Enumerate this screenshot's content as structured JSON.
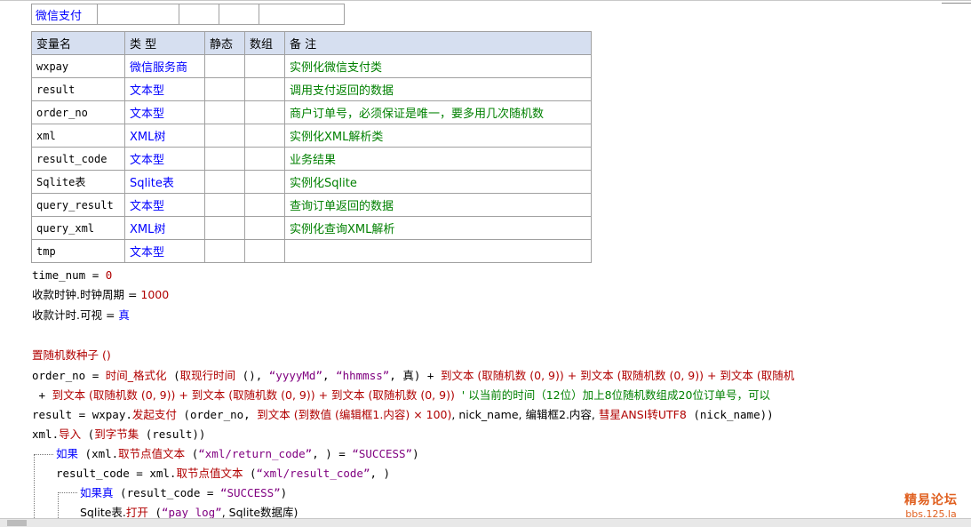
{
  "header_row": {
    "name": "微信支付"
  },
  "table": {
    "columns": [
      "变量名",
      "类 型",
      "静态",
      "数组",
      "备 注"
    ],
    "rows": [
      {
        "name": "wxpay",
        "type": "微信服务商",
        "static": "",
        "array": "",
        "note": "实例化微信支付类"
      },
      {
        "name": "result",
        "type": "文本型",
        "static": "",
        "array": "",
        "note": "调用支付返回的数据"
      },
      {
        "name": "order_no",
        "type": "文本型",
        "static": "",
        "array": "",
        "note": "商户订单号，必须保证是唯一，要多用几次随机数"
      },
      {
        "name": "xml",
        "type": "XML树",
        "static": "",
        "array": "",
        "note": "实例化XML解析类"
      },
      {
        "name": "result_code",
        "type": "文本型",
        "static": "",
        "array": "",
        "note": "业务结果"
      },
      {
        "name": "Sqlite表",
        "type": "Sqlite表",
        "static": "",
        "array": "",
        "note": "实例化Sqlite"
      },
      {
        "name": "query_result",
        "type": "文本型",
        "static": "",
        "array": "",
        "note": "查询订单返回的数据"
      },
      {
        "name": "query_xml",
        "type": "XML树",
        "static": "",
        "array": "",
        "note": "实例化查询XML解析"
      },
      {
        "name": "tmp",
        "type": "文本型",
        "static": "",
        "array": "",
        "note": ""
      }
    ]
  },
  "code": {
    "l1_a": "time_num",
    "l1_b": " = ",
    "l1_c": "0",
    "l2_a": "收款时钟.时钟周期",
    "l2_b": " = ",
    "l2_c": "1000",
    "l3_a": "收款计时.可视",
    "l3_b": " = ",
    "l3_c": "真",
    "l4": "置随机数种子 ()",
    "l5_a": "order_no = ",
    "l5_b": "时间_格式化",
    "l5_c": " (",
    "l5_d": "取现行时间",
    "l5_e": " (), ",
    "l5_f": "“yyyyMd”",
    "l5_g": ", ",
    "l5_h": "“hhmmss”",
    "l5_i": ", 真) + ",
    "l5_j": "到文本 (取随机数 (0, 9)) + 到文本 (取随机数 (0, 9)) + 到文本 (取随机",
    "l6_a": " + ",
    "l6_b": "到文本 (取随机数 (0, 9)) + 到文本 (取随机数 (0, 9)) + 到文本 (取随机数 (0, 9))",
    "l6_c": "  ' 以当前的时间（12位）加上8位随机数组成20位订单号，可以",
    "l7_a": "result = wxpay.",
    "l7_b": "发起支付",
    "l7_c": " (order_no, ",
    "l7_d": "到文本 (到数值 (编辑框1.内容) × 100)",
    "l7_e": ", nick_name, 编辑框2.内容, ",
    "l7_f": "彗星ANSI转UTF8",
    "l7_g": " (nick_name))",
    "l8_a": "xml.",
    "l8_b": "导入",
    "l8_c": " (",
    "l8_d": "到字节集",
    "l8_e": " (result))",
    "l9_a": "如果",
    "l9_b": " (xml.",
    "l9_c": "取节点值文本",
    "l9_d": " (",
    "l9_e": "“xml/return_code”",
    "l9_f": ", ) = ",
    "l9_g": "“SUCCESS”",
    "l9_h": ")",
    "l10_a": "result_code = xml.",
    "l10_b": "取节点值文本",
    "l10_c": " (",
    "l10_d": "“xml/result_code”",
    "l10_e": ", )",
    "l11_a": "如果真",
    "l11_b": " (result_code = ",
    "l11_c": "“SUCCESS”",
    "l11_d": ")",
    "l12_a": "Sqlite表.",
    "l12_b": "打开",
    "l12_c": " (",
    "l12_d": "“pay_log”",
    "l12_e": ", Sqlite数据库)"
  },
  "watermark": {
    "line1": "精易论坛",
    "line2": "bbs.125.la"
  },
  "colors": {
    "keyword": "#0000ff",
    "function": "#b00000",
    "comment": "#008000",
    "string": "#800080",
    "header_bg": "#d6dff0"
  }
}
